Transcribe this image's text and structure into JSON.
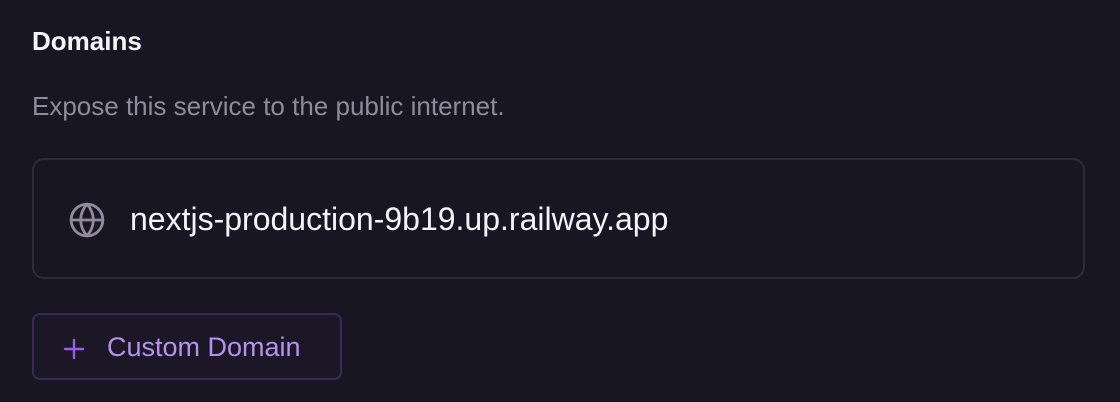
{
  "domains": {
    "title": "Domains",
    "description": "Expose this service to the public internet.",
    "items": [
      {
        "url": "nextjs-production-9b19.up.railway.app",
        "icon": "globe-icon"
      }
    ],
    "custom_domain_button": {
      "label": "Custom Domain",
      "icon": "plus-icon"
    },
    "colors": {
      "background": "#181622",
      "text": "#f4f3f8",
      "muted": "#8f8b9c",
      "accent": "#b592ee",
      "accent_icon": "#9b5de5",
      "border": "#2f2c3a"
    }
  }
}
